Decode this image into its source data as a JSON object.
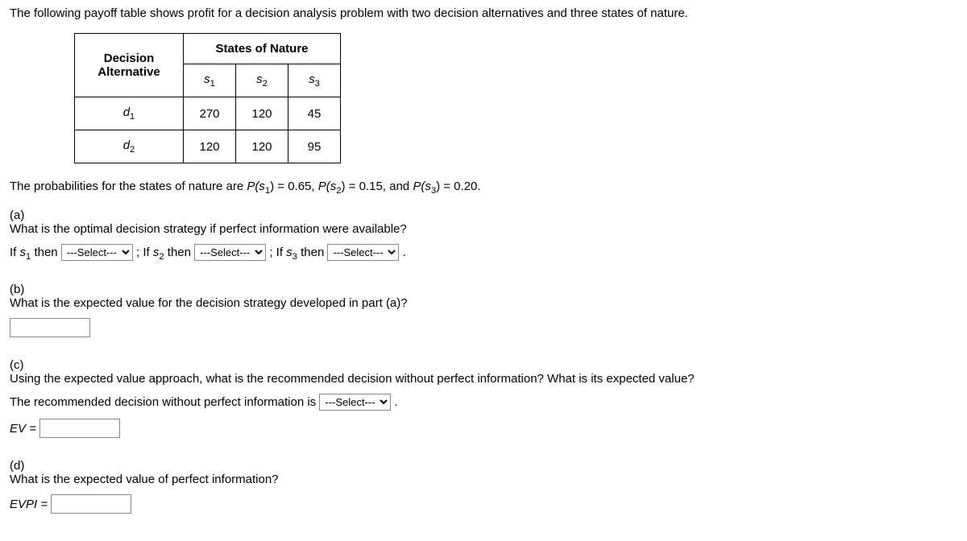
{
  "intro": "The following payoff table shows profit for a decision analysis problem with two decision alternatives and three states of nature.",
  "table": {
    "decision_header": "Decision Alternative",
    "states_header": "States of Nature",
    "cols": {
      "s1": "s",
      "s1sub": "1",
      "s2": "s",
      "s2sub": "2",
      "s3": "s",
      "s3sub": "3"
    },
    "rows": [
      {
        "label": "d",
        "labelsub": "1",
        "v1": "270",
        "v2": "120",
        "v3": "45"
      },
      {
        "label": "d",
        "labelsub": "2",
        "v1": "120",
        "v2": "120",
        "v3": "95"
      }
    ]
  },
  "prob_line": {
    "prefix": "The probabilities for the states of nature are ",
    "p1_lhs": "P(s",
    "p1_sub": "1",
    "p1_rhs": ") = 0.65, ",
    "p2_lhs": "P(s",
    "p2_sub": "2",
    "p2_rhs": ") = 0.15, and ",
    "p3_lhs": "P(s",
    "p3_sub": "3",
    "p3_rhs": ") = 0.20."
  },
  "a": {
    "label": "(a)",
    "question": "What is the optimal decision strategy if perfect information were available?",
    "if": "If ",
    "s": "s",
    "sub1": "1",
    "sub2": "2",
    "sub3": "3",
    "then": " then ",
    "sep": " ; ",
    "period": " ."
  },
  "b": {
    "label": "(b)",
    "question": "What is the expected value for the decision strategy developed in part (a)?"
  },
  "c": {
    "label": "(c)",
    "question": "Using the expected value approach, what is the recommended decision without perfect information? What is its expected value?",
    "rec_prefix": "The recommended decision without perfect information is ",
    "rec_suffix": " .",
    "ev_label": "EV = "
  },
  "d": {
    "label": "(d)",
    "question": "What is the expected value of perfect information?",
    "evpi_label": "EVPI = "
  },
  "select_placeholder": "---Select---",
  "chart_data": {
    "type": "table",
    "title": "Payoff table (profit)",
    "row_labels": [
      "d1",
      "d2"
    ],
    "column_headers": [
      "s1",
      "s2",
      "s3"
    ],
    "values": [
      [
        270,
        120,
        45
      ],
      [
        120,
        120,
        95
      ]
    ],
    "probabilities": {
      "s1": 0.65,
      "s2": 0.15,
      "s3": 0.2
    }
  }
}
